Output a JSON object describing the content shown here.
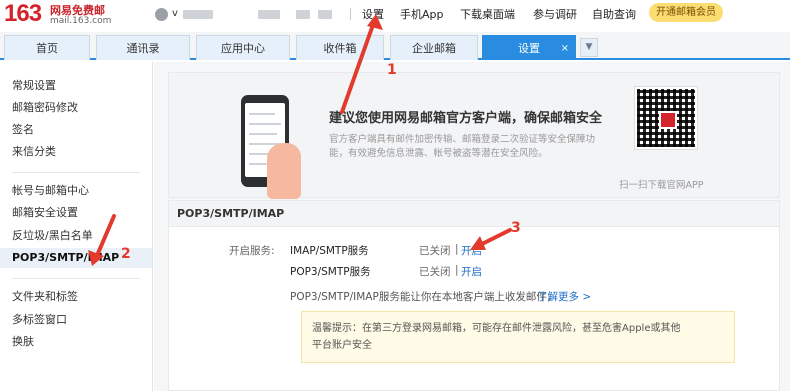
{
  "header": {
    "logo_number": "163",
    "logo_text": "网易免费邮",
    "logo_url": "mail.163.com",
    "user_visible": "v",
    "links": [
      {
        "label": "设置"
      },
      {
        "label": "手机App"
      },
      {
        "label": "下载桌面端"
      },
      {
        "label": "参与调研"
      },
      {
        "label": "自助查询"
      }
    ],
    "vip_button": "开通邮箱会员"
  },
  "tabs": [
    {
      "label": "首页"
    },
    {
      "label": "通讯录"
    },
    {
      "label": "应用中心"
    },
    {
      "label": "收件箱"
    },
    {
      "label": "企业邮箱"
    },
    {
      "label": "设置",
      "close": "×"
    }
  ],
  "tab_more_icon": "chevron-down",
  "sidebar": {
    "groups": [
      [
        "常规设置",
        "邮箱密码修改",
        "签名",
        "来信分类"
      ],
      [
        "帐号与邮箱中心",
        "邮箱安全设置",
        "反垃圾/黑白名单",
        "POP3/SMTP/IMAP"
      ],
      [
        "文件夹和标签",
        "多标签窗口",
        "换肤"
      ]
    ],
    "active": "POP3/SMTP/IMAP"
  },
  "banner": {
    "title": "建议您使用网易邮箱官方客户端，确保邮箱安全",
    "description": "官方客户端具有邮件加密传输、邮箱登录二次验证等安全保障功能，有效避免信息泄露、帐号被盗等潜在安全风险。",
    "qr_caption": "扫一扫下载官网APP"
  },
  "pop3": {
    "section_title": "POP3/SMTP/IMAP",
    "service_label": "开启服务:",
    "services": [
      {
        "name": "IMAP/SMTP服务",
        "status": "已关闭",
        "sep": "|",
        "action": "开启"
      },
      {
        "name": "POP3/SMTP服务",
        "status": "已关闭",
        "sep": "|",
        "action": "开启"
      }
    ],
    "note": "POP3/SMTP/IMAP服务能让你在本地客户端上收发邮件，",
    "learn_more": "了解更多 >",
    "tip_line1": "温馨提示：在第三方登录网易邮箱，可能存在邮件泄露风险，甚至危害Apple或其他",
    "tip_line2": "平台账户安全"
  },
  "annotations": [
    "1",
    "2",
    "3"
  ],
  "colors": {
    "brand_red": "#d4242b",
    "tab_active": "#2a8ce0",
    "link_blue": "#1f6fc9",
    "annotation_red": "#e23a2c",
    "vip_yellow": "#fcdd72"
  }
}
